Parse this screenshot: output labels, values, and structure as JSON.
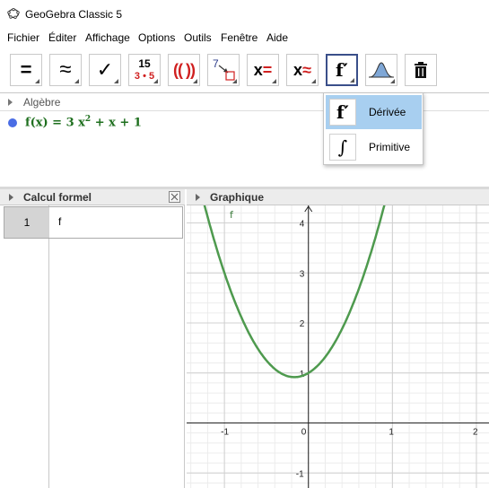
{
  "window": {
    "title": "GeoGebra Classic 5",
    "icon": "geogebra-app-icon"
  },
  "menu": [
    "Fichier",
    "Éditer",
    "Affichage",
    "Options",
    "Outils",
    "Fenêtre",
    "Aide"
  ],
  "toolbar": {
    "tools": [
      {
        "name": "evaluate-tool",
        "glyph": "="
      },
      {
        "name": "numeric-tool",
        "glyph": "≈"
      },
      {
        "name": "keep-input-tool",
        "glyph": "✓"
      },
      {
        "name": "factor-tool",
        "glyph_top": "15",
        "glyph_bottom": "3 • 5"
      },
      {
        "name": "expand-tool",
        "glyph": "( ( ) )"
      },
      {
        "name": "substitute-tool",
        "glyph": "7"
      },
      {
        "name": "solve-tool",
        "glyph": "x="
      },
      {
        "name": "solve-numerically-tool",
        "glyph": "x≈"
      },
      {
        "name": "derivative-tool",
        "glyph": "f′"
      },
      {
        "name": "probability-calculator-tool",
        "glyph": ""
      },
      {
        "name": "delete-tool",
        "glyph": ""
      }
    ],
    "active": "derivative-tool"
  },
  "algebra": {
    "header": "Algèbre",
    "items": [
      {
        "expr_lhs": "f(x) = 3 x",
        "expr_exp": "2",
        "expr_rhs": " + x + 1",
        "color": "#1e6f1e"
      }
    ]
  },
  "cas": {
    "header": "Calcul formel",
    "rows": [
      {
        "number": "1",
        "input": "f"
      }
    ]
  },
  "graphics": {
    "header": "Graphique",
    "curve_label": "f",
    "curve_color": "#4e9a4e",
    "x_ticks": [
      "-1",
      "0",
      "1",
      "2"
    ],
    "y_ticks": [
      "4",
      "3",
      "2",
      "1",
      "-1"
    ]
  },
  "dropdown": {
    "items": [
      {
        "icon": "derivative-icon",
        "glyph": "f′",
        "label": "Dérivée",
        "selected": true
      },
      {
        "icon": "integral-icon",
        "glyph": "∫",
        "label": "Primitive",
        "selected": false
      }
    ]
  },
  "chart_data": {
    "type": "line",
    "title": "",
    "xlabel": "",
    "ylabel": "",
    "xlim": [
      -1.45,
      2.15
    ],
    "ylim": [
      -1.3,
      4.35
    ],
    "grid": true,
    "series": [
      {
        "name": "f",
        "function": "3x^2 + x + 1",
        "x": [
          -1.2,
          -1.0,
          -0.8,
          -0.6,
          -0.4,
          -0.2,
          -0.1667,
          0,
          0.2,
          0.4,
          0.6,
          0.8
        ],
        "y": [
          4.12,
          3.0,
          2.12,
          1.48,
          1.08,
          0.92,
          0.917,
          1.0,
          1.32,
          1.88,
          2.68,
          3.72
        ]
      }
    ]
  }
}
